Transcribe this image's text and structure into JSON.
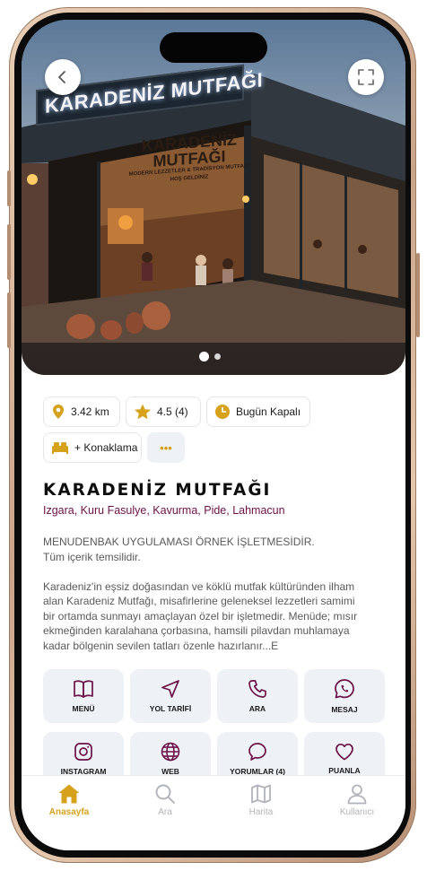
{
  "hero": {
    "sign_text": "KARADENİZ MUTFAĞI",
    "interior_sign": "KARADENİZ MUTFAĞI",
    "interior_sub": "MODERN LEZZETLER & TRADİSYON MUTFAĞI",
    "interior_welcome": "HOŞ GELDİNİZ",
    "back_icon": "chevron-left-icon",
    "fullscreen_icon": "expand-icon",
    "slide_count": 2,
    "active_slide": 1
  },
  "chips": {
    "distance": "3.42 km",
    "rating": "4.5 (4)",
    "hours": "Bugün Kapalı",
    "accommodation": "+ Konaklama",
    "more": "•••"
  },
  "venue": {
    "name": "KARADENİZ MUTFAĞI",
    "cuisines": "Izgara, Kuru Fasulye, Kavurma, Pide, Lahmacun",
    "notice_line1": "MENUDENBAK UYGULAMASI ÖRNEK İŞLETMESİDİR.",
    "notice_line2": "Tüm içerik temsilidir.",
    "description": "Karadeniz'in eşsiz doğasından ve köklü mutfak kültüründen ilham alan Karadeniz Mutfağı, misafirlerine geleneksel lezzetleri samimi bir ortamda sunmayı amaçlayan özel bir işletmedir. Menüde; mısır ekmeğinden karalahana çorbasına, hamsili pilavdan muhlamaya kadar bölgenin sevilen tatları özenle hazırlanır...E"
  },
  "actions": [
    {
      "label": "MENÜ",
      "icon": "book-icon"
    },
    {
      "label": "YOL TARİFİ",
      "icon": "navigation-icon"
    },
    {
      "label": "ARA",
      "icon": "phone-icon"
    },
    {
      "label": "MESAJ",
      "icon": "whatsapp-icon"
    },
    {
      "label": "INSTAGRAM",
      "icon": "instagram-icon"
    },
    {
      "label": "WEB",
      "icon": "globe-icon"
    },
    {
      "label": "YORUMLAR (4)",
      "icon": "comment-icon"
    },
    {
      "label": "PUANLA",
      "icon": "heart-icon"
    }
  ],
  "tabs": [
    {
      "label": "Anasayfa",
      "icon": "home-icon",
      "active": true
    },
    {
      "label": "Ara",
      "icon": "search-icon",
      "active": false
    },
    {
      "label": "Harita",
      "icon": "map-icon",
      "active": false
    },
    {
      "label": "Kullanıcı",
      "icon": "user-icon",
      "active": false
    }
  ],
  "colors": {
    "accent": "#d6a21c",
    "brand_purple": "#6b1248",
    "tile_bg": "#eef1f6",
    "inactive_tab": "#b0b4ba"
  }
}
